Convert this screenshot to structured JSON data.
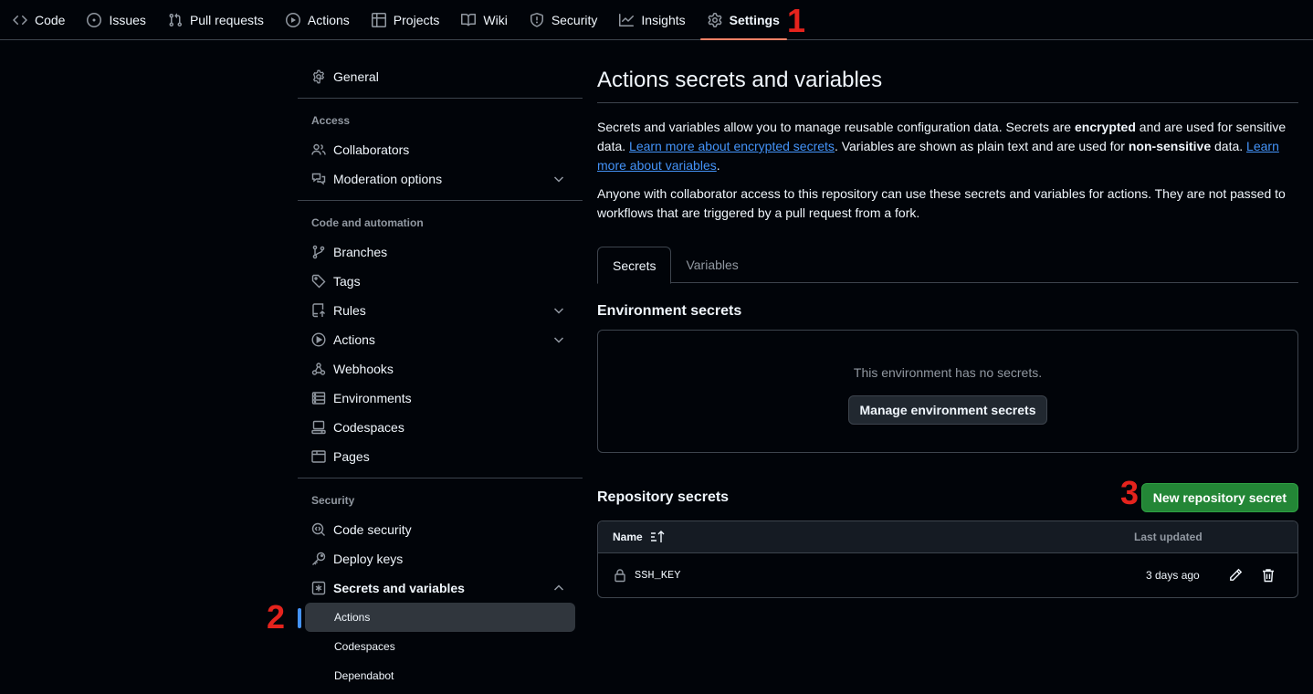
{
  "topnav": {
    "tabs": [
      {
        "label": "Code",
        "icon": "code-icon"
      },
      {
        "label": "Issues",
        "icon": "issue-opened-icon"
      },
      {
        "label": "Pull requests",
        "icon": "git-pull-request-icon"
      },
      {
        "label": "Actions",
        "icon": "play-icon"
      },
      {
        "label": "Projects",
        "icon": "table-icon"
      },
      {
        "label": "Wiki",
        "icon": "book-icon"
      },
      {
        "label": "Security",
        "icon": "shield-icon"
      },
      {
        "label": "Insights",
        "icon": "graph-icon"
      },
      {
        "label": "Settings",
        "icon": "gear-icon",
        "selected": true
      }
    ]
  },
  "annotations": {
    "one": "1",
    "two": "2",
    "three": "3",
    "color": "#e5231d"
  },
  "sidebar": {
    "general": "General",
    "access_heading": "Access",
    "collaborators": "Collaborators",
    "moderation": "Moderation options",
    "code_heading": "Code and automation",
    "branches": "Branches",
    "tags": "Tags",
    "rules": "Rules",
    "actions": "Actions",
    "webhooks": "Webhooks",
    "environments": "Environments",
    "codespaces": "Codespaces",
    "pages": "Pages",
    "security_heading": "Security",
    "code_security": "Code security",
    "deploy_keys": "Deploy keys",
    "secrets_variables": "Secrets and variables",
    "sub_actions": "Actions",
    "sub_codespaces": "Codespaces",
    "sub_dependabot": "Dependabot"
  },
  "main": {
    "title": "Actions secrets and variables",
    "intro": {
      "p1_a": "Secrets and variables allow you to manage reusable configuration data. Secrets are ",
      "p1_b": "encrypted",
      "p1_c": " and are used for sensitive data. ",
      "p1_link1": "Learn more about encrypted secrets",
      "p1_d": ". Variables are shown as plain text and are used for ",
      "p1_e": "non-sensitive",
      "p1_f": " data. ",
      "p1_link2": "Learn more about variables",
      "p1_g": ".",
      "p2": "Anyone with collaborator access to this repository can use these secrets and variables for actions. They are not passed to workflows that are triggered by a pull request from a fork."
    },
    "tabs": {
      "secrets": "Secrets",
      "variables": "Variables"
    },
    "env": {
      "title": "Environment secrets",
      "empty": "This environment has no secrets.",
      "button": "Manage environment secrets"
    },
    "repo": {
      "title": "Repository secrets",
      "new_button": "New repository secret",
      "col_name": "Name",
      "col_updated": "Last updated",
      "rows": [
        {
          "name": "SSH_KEY",
          "updated": "3 days ago"
        }
      ]
    }
  },
  "colors": {
    "background": "#010409",
    "border": "#3d444d",
    "accent_blue": "#4493f8",
    "selected_underline": "#f78166",
    "green_button": "#238636"
  }
}
